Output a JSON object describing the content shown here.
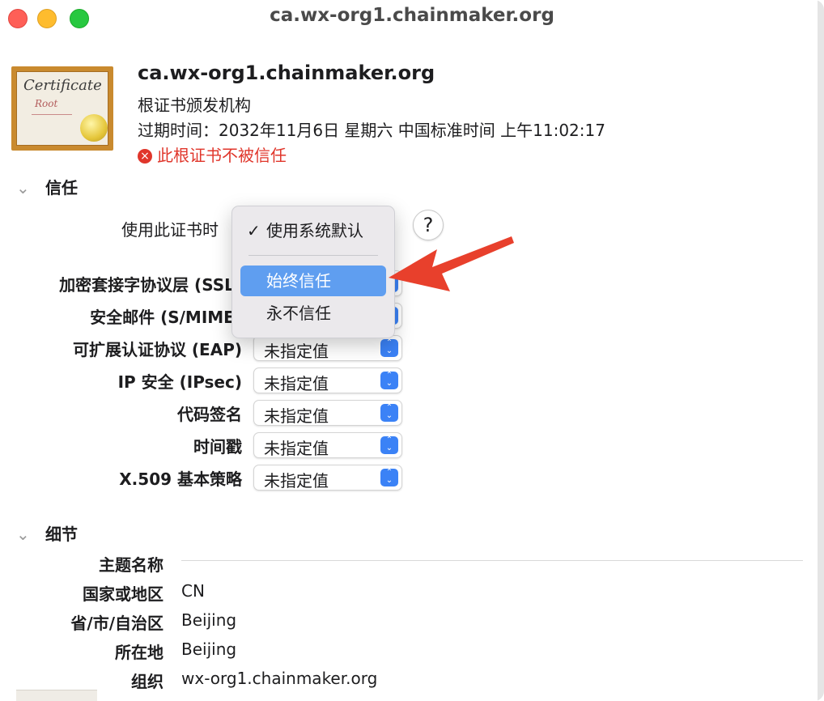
{
  "window": {
    "title": "ca.wx-org1.chainmaker.org"
  },
  "certificate": {
    "name": "ca.wx-org1.chainmaker.org",
    "type": "根证书颁发机构",
    "expiry": "过期时间：2032年11月6日 星期六 中国标准时间 上午11:02:17",
    "warning": "此根证书不被信任",
    "image_word": "Certificate",
    "image_root": "Root"
  },
  "trust": {
    "section_title": "信任",
    "use_label": "使用此证书时",
    "help_label": "?",
    "menu": {
      "items": [
        {
          "label": "使用系统默认",
          "checked": true
        },
        {
          "label": "始终信任",
          "highlighted": true
        },
        {
          "label": "永不信任"
        }
      ],
      "check_mark": "✓"
    },
    "policies": [
      {
        "label": "加密套接字协议层 (SSL)",
        "value": ""
      },
      {
        "label": "安全邮件 (S/MIME)",
        "value": ""
      },
      {
        "label": "可扩展认证协议 (EAP)",
        "value": "未指定值"
      },
      {
        "label": "IP 安全 (IPsec)",
        "value": "未指定值"
      },
      {
        "label": "代码签名",
        "value": "未指定值"
      },
      {
        "label": "时间戳",
        "value": "未指定值"
      },
      {
        "label": "X.509 基本策略",
        "value": "未指定值"
      }
    ]
  },
  "details": {
    "section_title": "细节",
    "subject_title": "主题名称",
    "rows": [
      {
        "label": "国家或地区",
        "value": "CN"
      },
      {
        "label": "省/市/自治区",
        "value": "Beijing"
      },
      {
        "label": "所在地",
        "value": "Beijing"
      },
      {
        "label": "组织",
        "value": "wx-org1.chainmaker.org"
      }
    ]
  },
  "colors": {
    "accent": "#3b82f6",
    "highlight": "#5f9ef0",
    "error": "#e0362b",
    "arrow": "#e8402c"
  }
}
